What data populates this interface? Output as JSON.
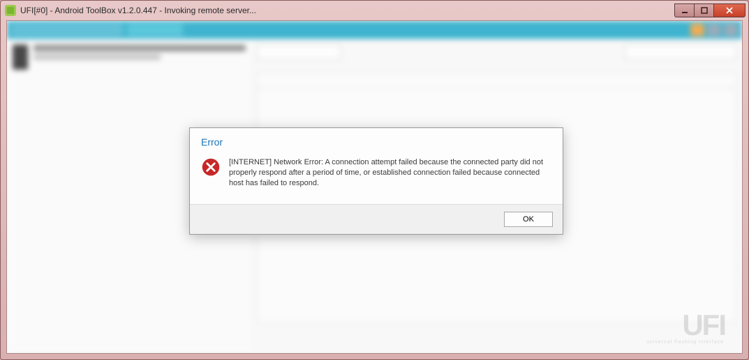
{
  "window": {
    "title": "UFI[#0] - Android ToolBox v1.2.0.447  - Invoking remote server..."
  },
  "dialog": {
    "title": "Error",
    "message": "[INTERNET] Network Error: A connection attempt failed because the connected party did not properly respond after a period of time, or established connection failed because connected host has failed to respond.",
    "ok_label": "OK"
  },
  "watermark": {
    "text": "UFI",
    "sub": "universal flashing interface"
  }
}
